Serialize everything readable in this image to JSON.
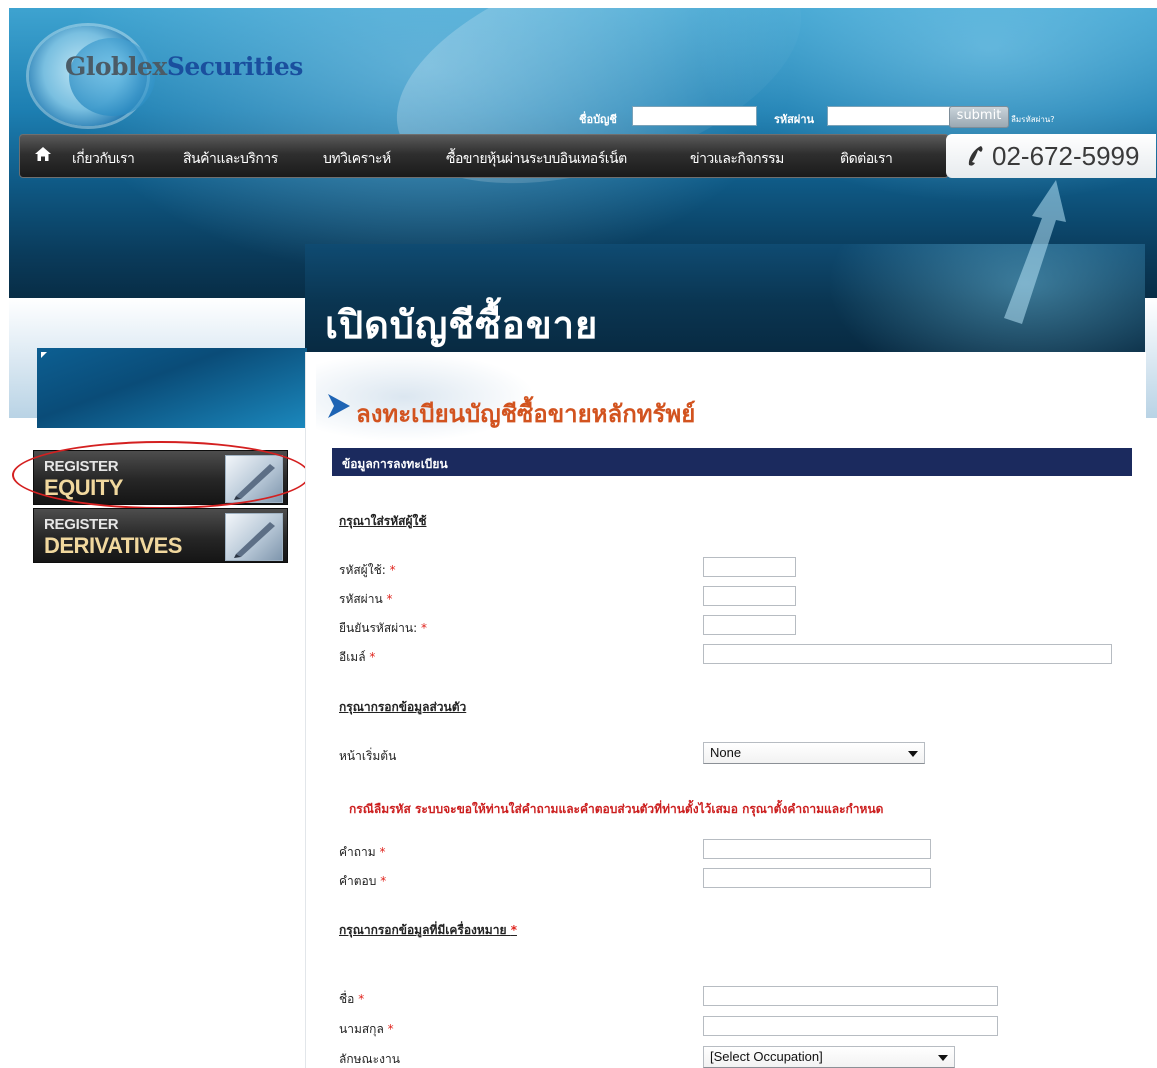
{
  "header": {
    "logo_word1": "Globlex",
    "logo_word2": "Securities",
    "login": {
      "account_label": "ชื่อบัญชี",
      "password_label": "รหัสผ่าน",
      "submit_label": "submit",
      "forgot_label": "ลืมรหัสผ่าน?"
    },
    "nav": [
      {
        "label": "เกี่ยวกับเรา"
      },
      {
        "label": "สินค้าและบริการ"
      },
      {
        "label": "บทวิเคราะห์"
      },
      {
        "label": "ซื้อขายหุ้นผ่านระบบอินเทอร์เน็ต"
      },
      {
        "label": "ข่าวและกิจกรรม"
      },
      {
        "label": "ติดต่อเรา"
      }
    ],
    "phone": "02-672-5999",
    "page_title": "เปิดบัญชีซื้อขาย"
  },
  "sidebar": {
    "buttons": [
      {
        "top": "REGISTER",
        "main": "EQUITY"
      },
      {
        "top": "REGISTER",
        "main": "DERIVATIVES"
      }
    ]
  },
  "main": {
    "section_title": "ลงทะเบียนบัญชีซื้อขายหลักทรัพย์",
    "form_bar": "ข้อมูลการลงทะเบียน",
    "user_section": "กรุณาใส่รหัสผู้ใช้",
    "username_label": "รหัสผู้ใช้:",
    "password_label": "รหัสผ่าน",
    "confirm_label": "ยืนยันรหัสผ่าน:",
    "email_label": "อีเมล์",
    "personal_section": "กรุณากรอกข้อมูลส่วนตัว",
    "homepage_label": "หน้าเริ่มต้น",
    "homepage_value": "None",
    "note": "กรณีลืมรหัส ระบบจะขอให้ท่านใส่คำถามและคำตอบส่วนตัวที่ท่านตั้งไว้เสมอ กรุณาตั้งคำถามและกำหนด",
    "question_label": "คำถาม",
    "answer_label": "คำตอบ",
    "marked_section": "กรุณากรอกข้อมูลที่มีเครื่องหมาย",
    "first_name_label": "ชื่อ",
    "last_name_label": "นามสกุล",
    "occupation_label": "ลักษณะงาน",
    "occupation_value": "[Select Occupation]",
    "required_mark": "*"
  },
  "colors": {
    "form_bar_bg": "#1b2a5e",
    "title_orange": "#d2531f",
    "required_red": "#e0241d",
    "highlight_ring": "#d42020"
  }
}
